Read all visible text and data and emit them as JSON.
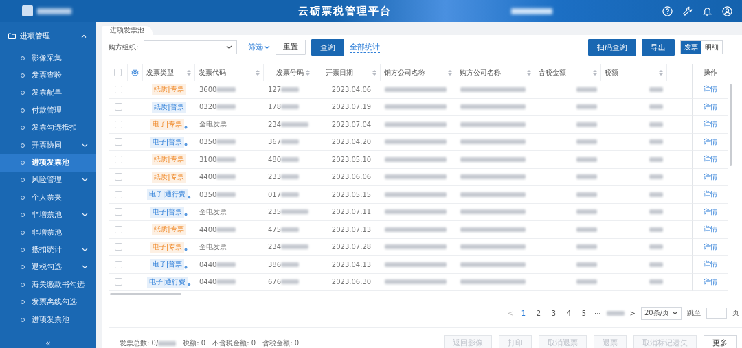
{
  "header": {
    "title": "云砺票税管理平台"
  },
  "sidebar": {
    "section": {
      "label": "进项管理",
      "expanded": true
    },
    "items": [
      {
        "label": "影像采集",
        "selected": false,
        "has_children": false
      },
      {
        "label": "发票查验",
        "selected": false,
        "has_children": false
      },
      {
        "label": "发票配单",
        "selected": false,
        "has_children": false
      },
      {
        "label": "付款管理",
        "selected": false,
        "has_children": false
      },
      {
        "label": "发票勾选抵扣",
        "selected": false,
        "has_children": false
      },
      {
        "label": "开票协同",
        "selected": false,
        "has_children": true
      },
      {
        "label": "进项发票池",
        "selected": true,
        "has_children": false
      },
      {
        "label": "风险管理",
        "selected": false,
        "has_children": true
      },
      {
        "label": "个人票夹",
        "selected": false,
        "has_children": false
      },
      {
        "label": "非增票池",
        "selected": false,
        "has_children": true
      },
      {
        "label": "非增票池",
        "selected": false,
        "has_children": false
      },
      {
        "label": "抵扣统计",
        "selected": false,
        "has_children": true
      },
      {
        "label": "退税勾选",
        "selected": false,
        "has_children": true
      },
      {
        "label": "海关缴款书勾选",
        "selected": false,
        "has_children": false
      },
      {
        "label": "发票离线勾选",
        "selected": false,
        "has_children": false
      },
      {
        "label": "进项发票池",
        "selected": false,
        "has_children": false
      }
    ],
    "collapse": "«"
  },
  "tabs": [
    {
      "label": "进项发票池",
      "selected": true
    }
  ],
  "toolbar": {
    "org_label": "购方组织:",
    "filter": "筛选",
    "reset": "重置",
    "query": "查询",
    "stats": "全部统计",
    "scan": "扫码查询",
    "export": "导出",
    "views": [
      {
        "label": "发票",
        "selected": true
      },
      {
        "label": "明细",
        "selected": false
      }
    ]
  },
  "table": {
    "select_all": {
      "checked": false
    },
    "columns": [
      "发票类型",
      "发票代码",
      "发票号码",
      "开票日期",
      "销方公司名称",
      "购方公司名称",
      "含税金额",
      "税额",
      "操作"
    ],
    "rows": [
      {
        "checked": false,
        "type": {
          "label": "纸质|专票",
          "kind": "special",
          "electronic": false
        },
        "code": "3600",
        "code_blurred": true,
        "number": "127",
        "date": "2023.04.06",
        "action": "详情"
      },
      {
        "checked": false,
        "type": {
          "label": "纸质|普票",
          "kind": "ordinary",
          "electronic": false
        },
        "code": "0320",
        "code_blurred": true,
        "number": "178",
        "date": "2023.07.19",
        "action": "详情"
      },
      {
        "checked": false,
        "type": {
          "label": "电子|专票",
          "kind": "special",
          "electronic": true
        },
        "code": "全电发票",
        "code_blurred": false,
        "number": "234",
        "date": "2023.07.04",
        "action": "详情"
      },
      {
        "checked": false,
        "type": {
          "label": "电子|普票",
          "kind": "ordinary",
          "electronic": true
        },
        "code": "0350",
        "code_blurred": true,
        "number": "367",
        "date": "2023.04.20",
        "action": "详情"
      },
      {
        "checked": false,
        "type": {
          "label": "纸质|专票",
          "kind": "special",
          "electronic": false
        },
        "code": "3100",
        "code_blurred": true,
        "number": "480",
        "date": "2023.05.10",
        "action": "详情"
      },
      {
        "checked": false,
        "type": {
          "label": "纸质|专票",
          "kind": "special",
          "electronic": false
        },
        "code": "4400",
        "code_blurred": true,
        "number": "233",
        "date": "2023.06.06",
        "action": "详情"
      },
      {
        "checked": false,
        "type": {
          "label": "电子|通行费",
          "kind": "ordinary",
          "electronic": true
        },
        "code": "0350",
        "code_blurred": true,
        "number": "017",
        "date": "2023.05.15",
        "action": "详情"
      },
      {
        "checked": false,
        "type": {
          "label": "电子|普票",
          "kind": "ordinary",
          "electronic": true
        },
        "code": "全电发票",
        "code_blurred": false,
        "number": "235",
        "date": "2023.07.11",
        "action": "详情"
      },
      {
        "checked": false,
        "type": {
          "label": "纸质|专票",
          "kind": "special",
          "electronic": false
        },
        "code": "4400",
        "code_blurred": true,
        "number": "475",
        "date": "2023.07.13",
        "action": "详情"
      },
      {
        "checked": false,
        "type": {
          "label": "电子|专票",
          "kind": "special",
          "electronic": true
        },
        "code": "全电发票",
        "code_blurred": false,
        "number": "234",
        "date": "2023.07.28",
        "action": "详情"
      },
      {
        "checked": false,
        "type": {
          "label": "电子|普票",
          "kind": "ordinary",
          "electronic": true
        },
        "code": "0440",
        "code_blurred": true,
        "number": "386",
        "date": "2023.04.13",
        "action": "详情"
      },
      {
        "checked": false,
        "type": {
          "label": "电子|通行费",
          "kind": "ordinary",
          "electronic": true
        },
        "code": "0440",
        "code_blurred": true,
        "number": "676",
        "date": "2023.06.30",
        "action": "详情"
      }
    ]
  },
  "pagination": {
    "pages": [
      {
        "label": "1",
        "selected": true
      },
      {
        "label": "2",
        "selected": false
      },
      {
        "label": "3",
        "selected": false
      },
      {
        "label": "4",
        "selected": false
      },
      {
        "label": "5",
        "selected": false
      }
    ],
    "ellipsis": "···",
    "prev": "<",
    "next": ">",
    "page_size": "20条/页",
    "jump_label": "跳至",
    "page_unit": "页"
  },
  "footer": {
    "total_label": "发票总数: 0/",
    "stats": [
      "税额: 0",
      "不含税金额: 0",
      "含税金额: 0"
    ],
    "buttons": [
      {
        "label": "返回影像",
        "disabled": true
      },
      {
        "label": "打印",
        "disabled": true
      },
      {
        "label": "取消退票",
        "disabled": true
      },
      {
        "label": "退票",
        "disabled": true
      },
      {
        "label": "取消标记遗失",
        "disabled": true
      },
      {
        "label": "更多",
        "disabled": false
      }
    ]
  }
}
